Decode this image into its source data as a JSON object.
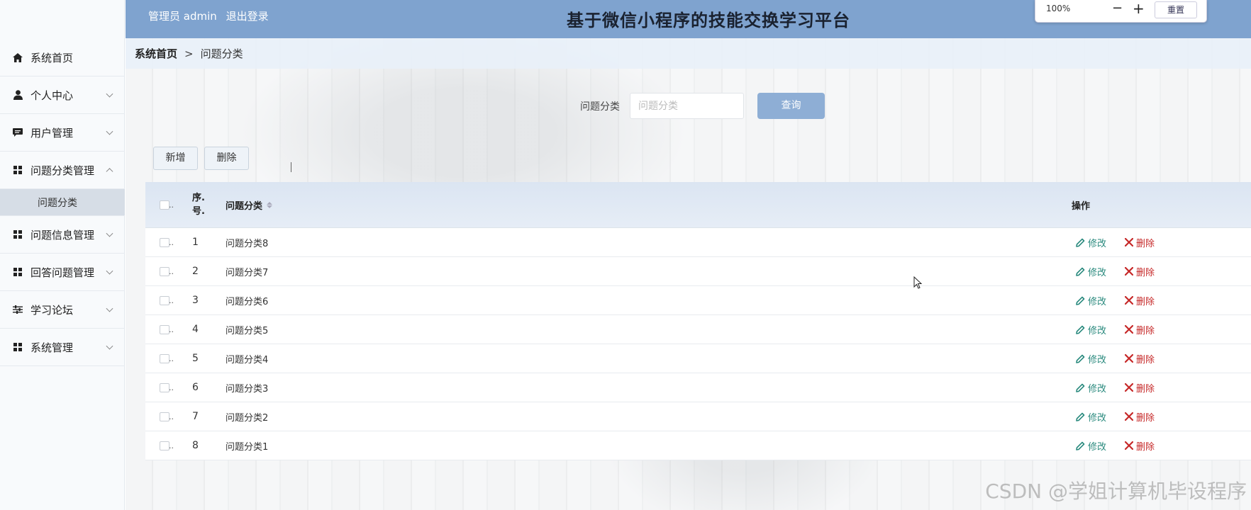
{
  "header": {
    "admin_label": "管理员 admin",
    "logout_label": "退出登录",
    "site_title": "基于微信小程序的技能交换学习平台",
    "zoom": {
      "value": "100%",
      "minus": "−",
      "plus": "+",
      "reset": "重置"
    }
  },
  "sidebar": {
    "items": [
      {
        "label": "系统首页",
        "icon": "home-icon"
      },
      {
        "label": "个人中心",
        "icon": "user-icon",
        "expandable": true
      },
      {
        "label": "用户管理",
        "icon": "chat-icon",
        "expandable": true
      },
      {
        "label": "问题分类管理",
        "icon": "grid-icon",
        "expandable": true,
        "expanded": true
      },
      {
        "label": "问题信息管理",
        "icon": "grid-icon",
        "expandable": true
      },
      {
        "label": "回答问题管理",
        "icon": "grid-icon",
        "expandable": true
      },
      {
        "label": "学习论坛",
        "icon": "sliders-icon",
        "expandable": true
      },
      {
        "label": "系统管理",
        "icon": "grid-icon",
        "expandable": true
      }
    ],
    "sub_item": "问题分类"
  },
  "breadcrumb": {
    "home": "系统首页",
    "sep": ">",
    "current": "问题分类"
  },
  "search": {
    "label": "问题分类",
    "placeholder": "问题分类",
    "button": "查询"
  },
  "actions": {
    "add": "新增",
    "delete": "删除"
  },
  "table": {
    "headers": {
      "check": "..",
      "index": "序.号.",
      "name": "问题分类",
      "ops": "操作"
    },
    "edit_label": "修改",
    "delete_label": "删除",
    "rows": [
      {
        "index": "1",
        "name": "问题分类8"
      },
      {
        "index": "2",
        "name": "问题分类7"
      },
      {
        "index": "3",
        "name": "问题分类6"
      },
      {
        "index": "4",
        "name": "问题分类5"
      },
      {
        "index": "5",
        "name": "问题分类4"
      },
      {
        "index": "6",
        "name": "问题分类3"
      },
      {
        "index": "7",
        "name": "问题分类2"
      },
      {
        "index": "8",
        "name": "问题分类1"
      }
    ]
  },
  "watermark": "CSDN @学姐计算机毕设程序",
  "colors": {
    "header_bg": "#7fa3cf",
    "search_btn": "#8eaed5",
    "edit": "#2a8a7e",
    "delete": "#c62828"
  }
}
